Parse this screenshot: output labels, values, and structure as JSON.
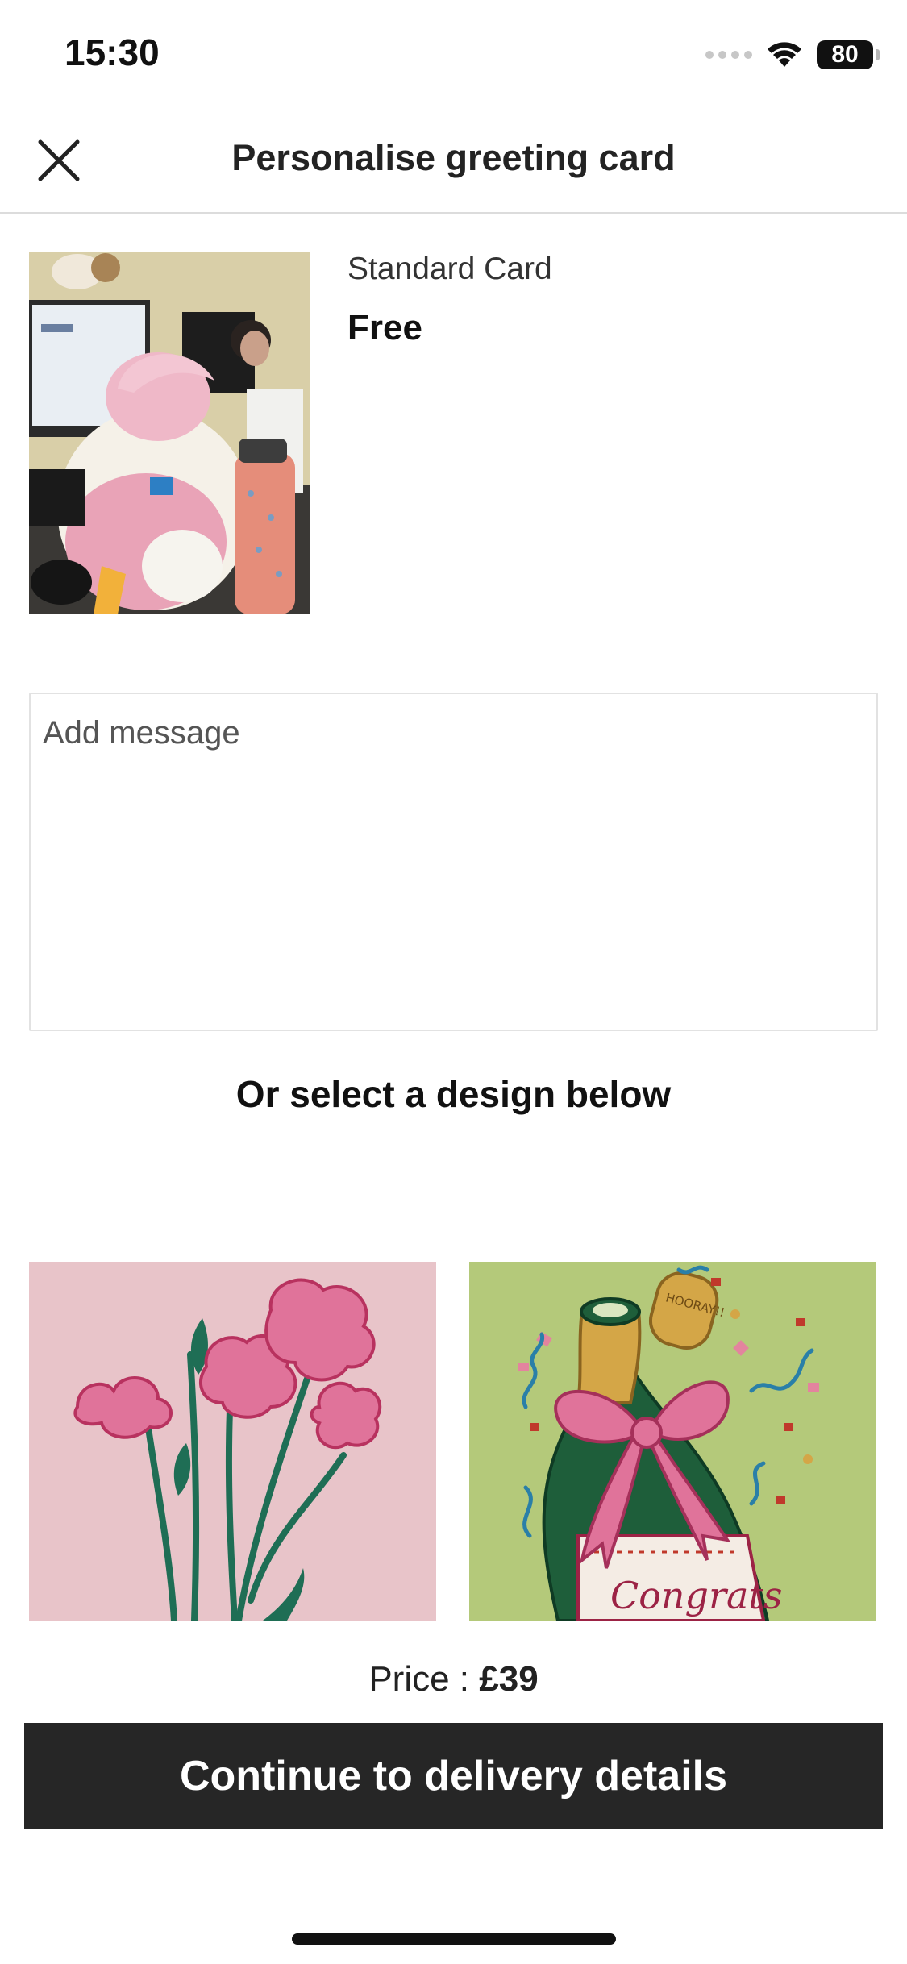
{
  "status_bar": {
    "time": "15:30",
    "battery": "80",
    "icons": [
      "signal-dots-icon",
      "wifi-icon",
      "battery-icon"
    ]
  },
  "header": {
    "title": "Personalise greeting card",
    "close_icon": "close-icon"
  },
  "card": {
    "type": "Standard Card",
    "price": "Free"
  },
  "message": {
    "placeholder": "Add message",
    "value": ""
  },
  "designs": {
    "heading": "Or select a design below",
    "items": [
      {
        "kind": "carnations-illustration",
        "background": "#e8c4c9"
      },
      {
        "kind": "champagne-illustration",
        "background": "#b4c97a",
        "bottle_text": "HOORAY!!",
        "label_text": "Congrats"
      }
    ]
  },
  "footer": {
    "price_label": "Price : ",
    "price_value": "£39",
    "continue_label": "Continue to delivery details"
  },
  "colors": {
    "button_bg": "#262626",
    "divider": "#dcdcdc"
  }
}
